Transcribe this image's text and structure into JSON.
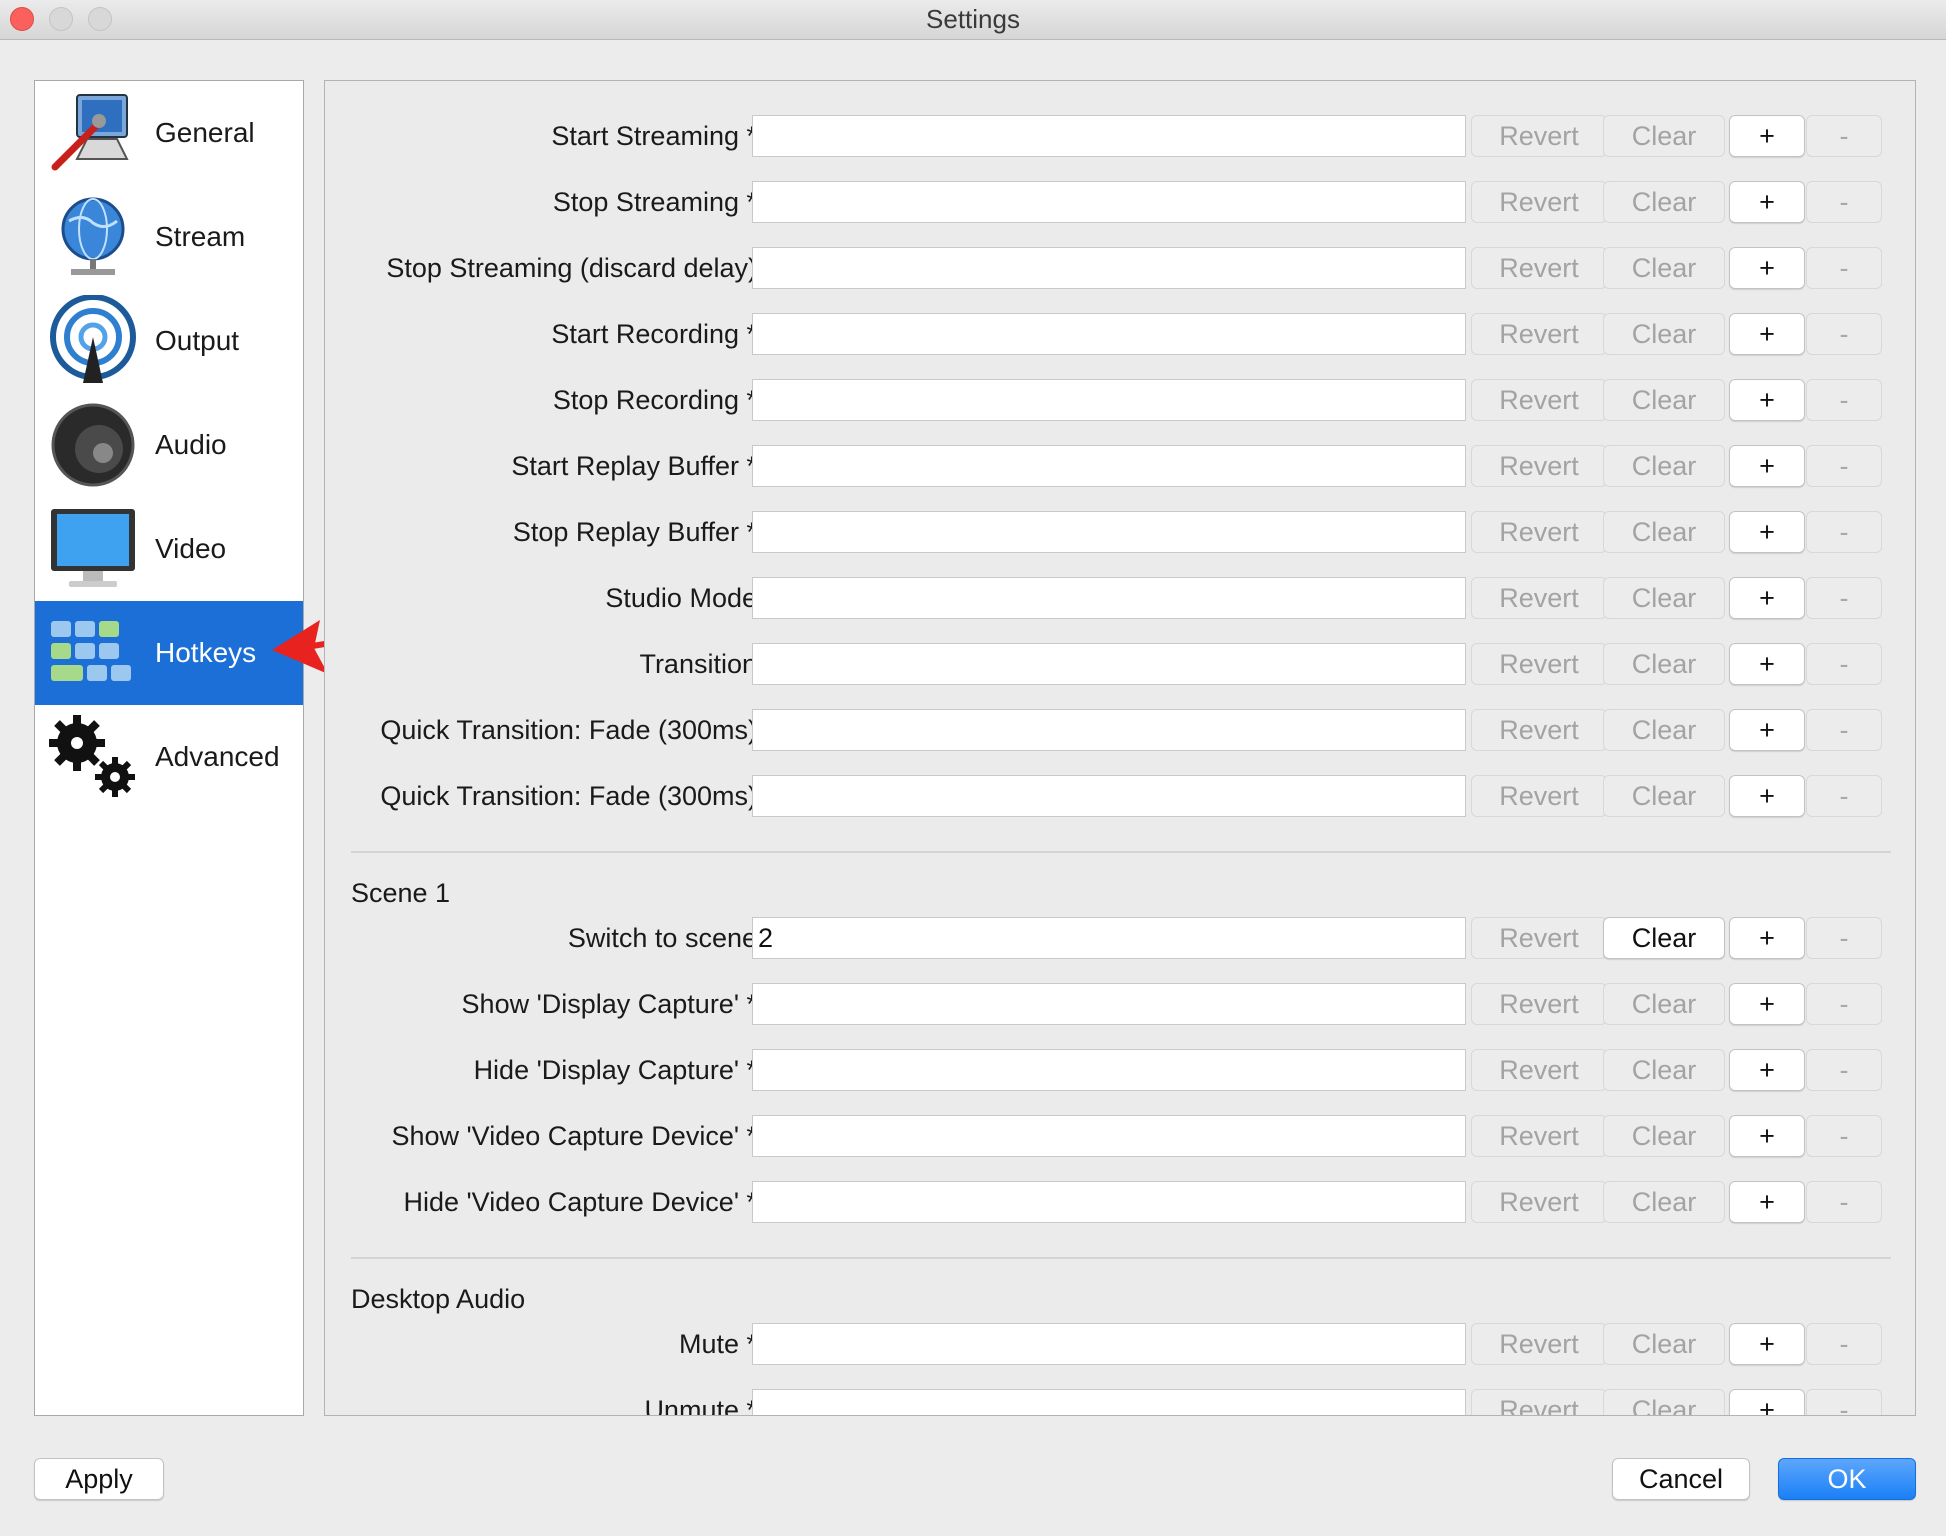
{
  "window": {
    "title": "Settings"
  },
  "sidebar": {
    "items": [
      {
        "label": "General",
        "icon": "computer-wrench-icon",
        "active": false
      },
      {
        "label": "Stream",
        "icon": "globe-network-icon",
        "active": false
      },
      {
        "label": "Output",
        "icon": "broadcast-antenna-icon",
        "active": false
      },
      {
        "label": "Audio",
        "icon": "speaker-icon",
        "active": false
      },
      {
        "label": "Video",
        "icon": "monitor-icon",
        "active": false
      },
      {
        "label": "Hotkeys",
        "icon": "keyboard-icon",
        "active": true
      },
      {
        "label": "Advanced",
        "icon": "gears-icon",
        "active": false
      }
    ]
  },
  "buttons": {
    "revert": "Revert",
    "clear": "Clear",
    "add": "+",
    "remove": "-"
  },
  "general_hotkeys": [
    {
      "label": "Start Streaming *",
      "value": ""
    },
    {
      "label": "Stop Streaming *",
      "value": ""
    },
    {
      "label": "Stop Streaming (discard delay)",
      "value": ""
    },
    {
      "label": "Start Recording *",
      "value": ""
    },
    {
      "label": "Stop Recording *",
      "value": ""
    },
    {
      "label": "Start Replay Buffer *",
      "value": ""
    },
    {
      "label": "Stop Replay Buffer *",
      "value": ""
    },
    {
      "label": "Studio Mode",
      "value": ""
    },
    {
      "label": "Transition",
      "value": ""
    },
    {
      "label": "Quick Transition: Fade (300ms)",
      "value": ""
    },
    {
      "label": "Quick Transition: Fade (300ms)",
      "value": ""
    }
  ],
  "scene_section": {
    "title": "Scene 1",
    "hotkeys": [
      {
        "label": "Switch to scene",
        "value": "2",
        "clear_enabled": true
      },
      {
        "label": "Show 'Display Capture' *",
        "value": ""
      },
      {
        "label": "Hide 'Display Capture' *",
        "value": ""
      },
      {
        "label": "Show 'Video Capture Device' *",
        "value": ""
      },
      {
        "label": "Hide 'Video Capture Device' *",
        "value": ""
      }
    ]
  },
  "audio_section": {
    "title": "Desktop Audio",
    "hotkeys": [
      {
        "label": "Mute *",
        "value": ""
      },
      {
        "label": "Unmute *",
        "value": ""
      }
    ]
  },
  "footer": {
    "apply": "Apply",
    "cancel": "Cancel",
    "ok": "OK"
  },
  "colors": {
    "accent": "#1b6fd6",
    "ok_button": "#1a80f6",
    "annotation_arrow": "#e8231f"
  }
}
